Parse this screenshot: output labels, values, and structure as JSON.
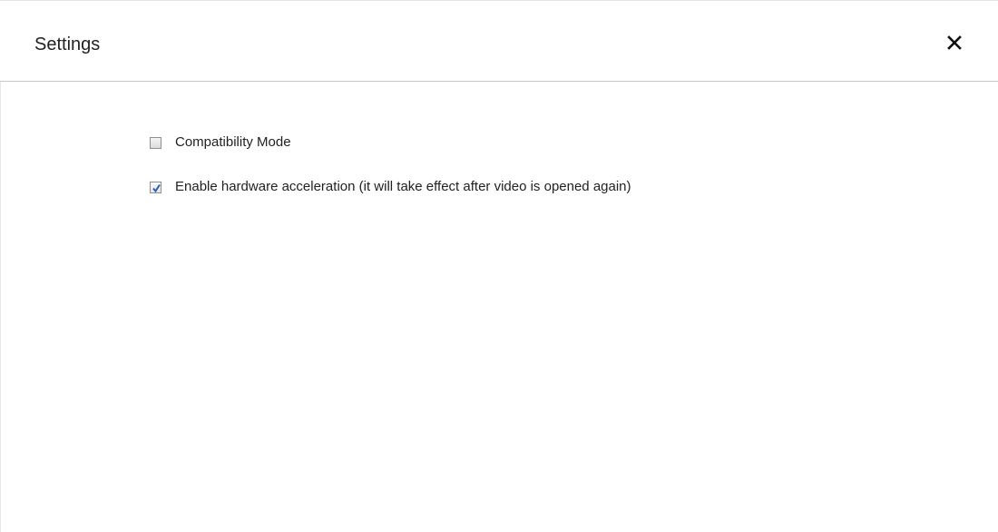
{
  "dialog": {
    "title": "Settings",
    "close_icon": "close-icon"
  },
  "options": [
    {
      "label": "Compatibility Mode",
      "checked": false
    },
    {
      "label": "Enable hardware acceleration (it will take effect after video is opened again)",
      "checked": true
    }
  ],
  "colors": {
    "checkmark": "#2b5fb4",
    "text": "#222222",
    "divider": "#c8c8c8"
  }
}
